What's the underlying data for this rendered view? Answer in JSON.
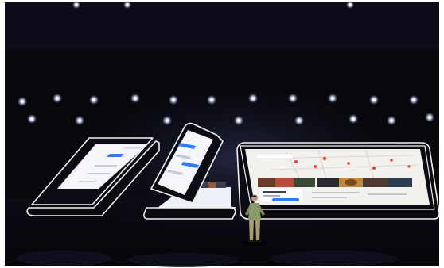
{
  "scene": {
    "background_color": "#07070c",
    "frame_color": "#ffffff",
    "outline_color": "#f2f2f2",
    "accent_blue": "#2f7cf6",
    "map_pin_red": "#e0443a",
    "presenter_shirt_color": "#8a9a6a"
  },
  "devices": [
    {
      "name": "folded-phone-left",
      "screen_content": "chat"
    },
    {
      "name": "half-folded-phone-center",
      "screen_content": "chat-and-photos"
    },
    {
      "name": "unfolded-tablet-right",
      "screen_content": "map-and-photos"
    }
  ],
  "stage_light_count": 22,
  "icons": [
    "stage-light-icon",
    "presenter-figure"
  ]
}
